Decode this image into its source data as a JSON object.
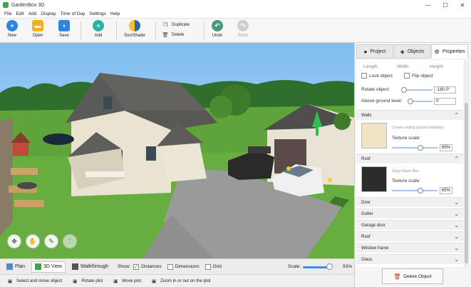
{
  "window": {
    "title": "GardenBox 3D"
  },
  "menu": [
    "File",
    "Edit",
    "Add",
    "Display",
    "Time of Day",
    "Settings",
    "Help"
  ],
  "toolbar": {
    "new": "New",
    "open": "Open",
    "save": "Save",
    "add": "Add",
    "sun_shade": "Sun/Shade",
    "duplicate": "Duplicate",
    "delete": "Delete",
    "undo": "Undo",
    "redo": "Redo"
  },
  "viewbar": {
    "plan": "Plan",
    "view3d": "3D View",
    "walkthrough": "Walkthrough",
    "show_label": "Show:",
    "distances": "Distances",
    "dimensions": "Dimensions",
    "grid": "Grid",
    "scale_label": "Scale:",
    "scale_value": "93%",
    "scale_fraction": 0.93,
    "distances_checked": true,
    "dimensions_checked": false,
    "grid_checked": false
  },
  "status": {
    "hint1": "Select and move object",
    "hint2": "Rotate plot",
    "hint3": "Move plot",
    "hint4": "Zoom in or out on the plot"
  },
  "panel": {
    "tabs": [
      "Project",
      "Objects",
      "Properties"
    ],
    "active_tab": "Properties",
    "dims": {
      "length": "Length",
      "width": "Width",
      "height": "Height"
    },
    "lock_object": "Lock object",
    "flip_object": "Flip object",
    "rotate_label": "Rotate object:",
    "rotate_value": "-180.0°",
    "above_label": "Above ground level:",
    "above_value": "0'",
    "walls": {
      "title": "Walls",
      "material": "Cream siding (wood imitation)",
      "texture_label": "Texture scale:",
      "texture_value": "65%"
    },
    "roof": {
      "title": "Roof",
      "material": "Gray-black tiles",
      "texture_label": "Texture scale:",
      "texture_value": "65%"
    },
    "collapsed": [
      "Door",
      "Gutter",
      "Garage door",
      "Roof",
      "Window frame",
      "Glass"
    ],
    "delete_button": "Delete Object"
  },
  "colors": {
    "accent_blue": "#3a8de0",
    "grass": "#5fa43a",
    "sky": "#8fc6f0",
    "teal_add": "#28b4a0"
  }
}
